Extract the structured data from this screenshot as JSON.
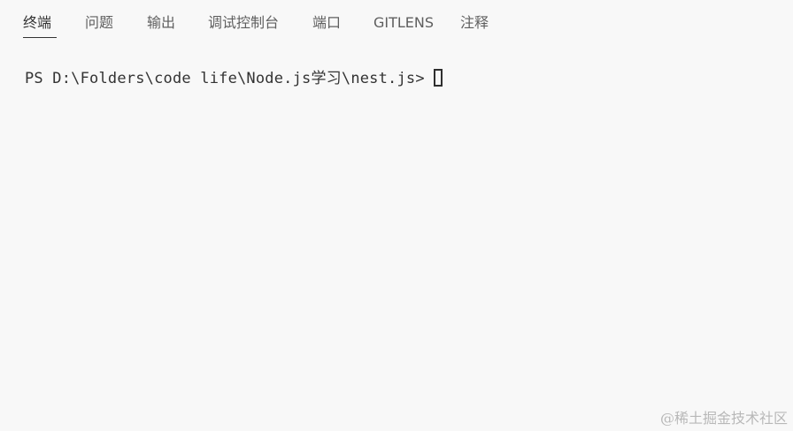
{
  "panel": {
    "tabs": [
      {
        "label": "终端",
        "active": true
      },
      {
        "label": "问题",
        "active": false
      },
      {
        "label": "输出",
        "active": false
      },
      {
        "label": "调试控制台",
        "active": false
      },
      {
        "label": "端口",
        "active": false
      },
      {
        "label": "GITLENS",
        "active": false
      },
      {
        "label": "注释",
        "active": false
      }
    ]
  },
  "terminal": {
    "prompt": "PS D:\\Folders\\code life\\Node.js学习\\nest.js>"
  },
  "watermark": {
    "text": "@稀土掘金技术社区"
  },
  "colors": {
    "background": "#f8f8f8",
    "active_tab": "#333333",
    "inactive_tab": "#5f5f5f",
    "watermark": "#b8b8b8"
  }
}
